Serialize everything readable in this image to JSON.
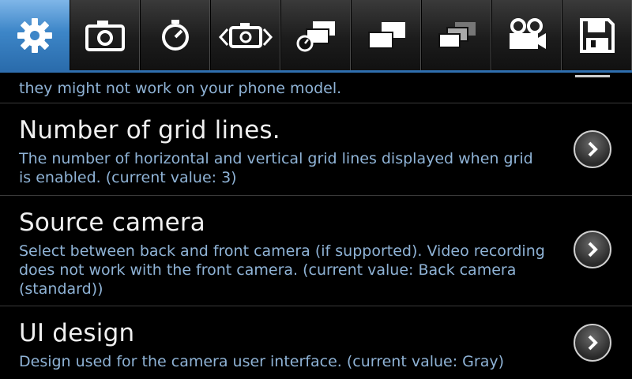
{
  "tabs": [
    {
      "icon": "gear-icon",
      "active": true
    },
    {
      "icon": "camera-icon",
      "active": false
    },
    {
      "icon": "timer-icon",
      "active": false
    },
    {
      "icon": "panorama-camera-icon",
      "active": false
    },
    {
      "icon": "burst-timer-icon",
      "active": false
    },
    {
      "icon": "burst-icon",
      "active": false
    },
    {
      "icon": "burst-fade-icon",
      "active": false
    },
    {
      "icon": "video-camera-icon",
      "active": false
    },
    {
      "icon": "save-icon",
      "active": false
    }
  ],
  "partial_item": {
    "description": "they might not work on your phone model."
  },
  "items": [
    {
      "title": "Number of grid lines.",
      "description": "The number of horizontal and vertical grid lines displayed when grid is enabled. (current value: 3)"
    },
    {
      "title": "Source camera",
      "description": "Select between back and front camera (if supported). Video recording does not work with the front camera. (current value: Back camera (standard))"
    },
    {
      "title": "UI design",
      "description": "Design used for the camera user interface. (current value: Gray)"
    }
  ],
  "colors": {
    "accent": "#3d86c8",
    "description_text": "#8fb3d6",
    "background": "#000000"
  }
}
